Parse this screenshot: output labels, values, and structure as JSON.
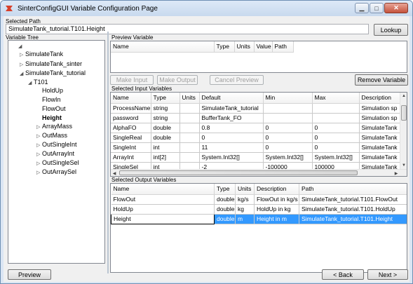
{
  "window": {
    "title": "SinterConfigGUI Variable Configuration Page"
  },
  "selected_path": {
    "label": "Selected Path",
    "value": "SimulateTank_tutorial.T101.Height",
    "lookup_label": "Lookup"
  },
  "tree": {
    "label": "Variable Tree",
    "nodes": [
      {
        "label": "SimulateTank",
        "arrow": "▷"
      },
      {
        "label": "SimulateTank_sinter",
        "arrow": "▷"
      },
      {
        "label": "SimulateTank_tutorial",
        "arrow": "◢"
      },
      {
        "label": "T101",
        "arrow": "◢"
      },
      {
        "label": "HoldUp",
        "arrow": ""
      },
      {
        "label": "FlowIn",
        "arrow": ""
      },
      {
        "label": "FlowOut",
        "arrow": ""
      },
      {
        "label": "Height",
        "arrow": ""
      },
      {
        "label": "ArrayMass",
        "arrow": "▷"
      },
      {
        "label": "OutMass",
        "arrow": "▷"
      },
      {
        "label": "OutSingleInt",
        "arrow": "▷"
      },
      {
        "label": "OutArrayInt",
        "arrow": "▷"
      },
      {
        "label": "OutSingleSel",
        "arrow": "▷"
      },
      {
        "label": "OutArraySel",
        "arrow": "▷"
      }
    ]
  },
  "preview": {
    "label": "Preview Variable",
    "columns": [
      "Name",
      "Type",
      "Units",
      "Value",
      "Path"
    ]
  },
  "actions": {
    "make_input": "Make Input",
    "make_output": "Make Output",
    "cancel_preview": "Cancel Preview",
    "remove_variable": "Remove Variable"
  },
  "inputs": {
    "label": "Selected Input Variables",
    "columns": [
      "Name",
      "Type",
      "Units",
      "Default",
      "Min",
      "Max",
      "Description"
    ],
    "rows": [
      [
        "ProcessName",
        "string",
        "",
        "SimulateTank_tutorial",
        "",
        "",
        "Simulation sp"
      ],
      [
        "password",
        "string",
        "",
        "BufferTank_FO",
        "",
        "",
        "Simulation sp"
      ],
      [
        "AlphaFO",
        "double",
        "",
        "0.8",
        "0",
        "0",
        "SimulateTank"
      ],
      [
        "SingleReal",
        "double",
        "",
        "0",
        "0",
        "0",
        "SimulateTank"
      ],
      [
        "SingleInt",
        "int",
        "",
        "11",
        "0",
        "0",
        "SimulateTank"
      ],
      [
        "ArrayInt",
        "int[2]",
        "",
        "System.Int32[]",
        "System.Int32[]",
        "System.Int32[]",
        "SimulateTank"
      ],
      [
        "SingleSel",
        "int",
        "",
        "-2",
        "-100000",
        "100000",
        "SimulateTank"
      ]
    ]
  },
  "outputs": {
    "label": "Selected Output Variables",
    "columns": [
      "Name",
      "Type",
      "Units",
      "Description",
      "Path"
    ],
    "rows": [
      [
        "FlowOut",
        "double",
        "kg/s",
        "FlowOut in kg/s",
        "SimulateTank_tutorial.T101.FlowOut"
      ],
      [
        "HoldUp",
        "double",
        "kg",
        "HoldUp in kg",
        "SimulateTank_tutorial.T101.HoldUp"
      ],
      [
        "Height",
        "double",
        "m",
        "Height in m",
        "SimulateTank_tutorial.T101.Height"
      ]
    ]
  },
  "footer": {
    "preview": "Preview",
    "back": "< Back",
    "next": "Next >"
  }
}
